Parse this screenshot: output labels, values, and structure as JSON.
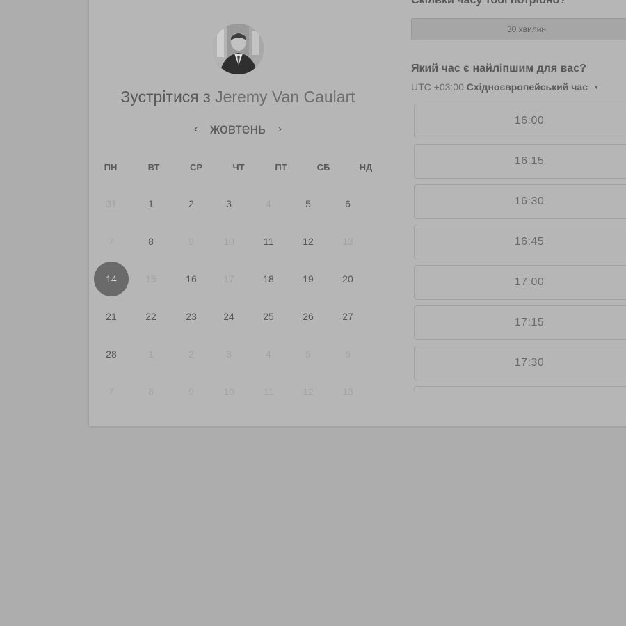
{
  "host": {
    "title_prefix": "Зустрітися з",
    "name": "Jeremy Van Caulart"
  },
  "calendar": {
    "month": "жовтень",
    "prev_icon": "chevron-left-icon",
    "next_icon": "chevron-right-icon",
    "weekdays": [
      "ПН",
      "ВТ",
      "СР",
      "ЧТ",
      "ПТ",
      "СБ",
      "НД"
    ],
    "weeks": [
      [
        {
          "d": "31",
          "muted": true
        },
        {
          "d": "1"
        },
        {
          "d": "2"
        },
        {
          "d": "3"
        },
        {
          "d": "4",
          "muted": true
        },
        {
          "d": "5"
        },
        {
          "d": "6"
        }
      ],
      [
        {
          "d": "7",
          "muted": true
        },
        {
          "d": "8"
        },
        {
          "d": "9",
          "muted": true
        },
        {
          "d": "10",
          "muted": true
        },
        {
          "d": "11"
        },
        {
          "d": "12"
        },
        {
          "d": "13",
          "muted": true
        }
      ],
      [
        {
          "d": "14",
          "selected": true
        },
        {
          "d": "15",
          "muted": true
        },
        {
          "d": "16"
        },
        {
          "d": "17",
          "muted": true
        },
        {
          "d": "18"
        },
        {
          "d": "19"
        },
        {
          "d": "20"
        }
      ],
      [
        {
          "d": "21"
        },
        {
          "d": "22"
        },
        {
          "d": "23"
        },
        {
          "d": "24"
        },
        {
          "d": "25"
        },
        {
          "d": "26"
        },
        {
          "d": "27"
        }
      ],
      [
        {
          "d": "28"
        },
        {
          "d": "1",
          "muted": true
        },
        {
          "d": "2",
          "muted": true
        },
        {
          "d": "3",
          "muted": true
        },
        {
          "d": "4",
          "muted": true
        },
        {
          "d": "5",
          "muted": true
        },
        {
          "d": "6",
          "muted": true
        }
      ],
      [
        {
          "d": "7",
          "muted": true
        },
        {
          "d": "8",
          "muted": true
        },
        {
          "d": "9",
          "muted": true
        },
        {
          "d": "10",
          "muted": true
        },
        {
          "d": "11",
          "muted": true
        },
        {
          "d": "12",
          "muted": true
        },
        {
          "d": "13",
          "muted": true
        }
      ]
    ]
  },
  "booking": {
    "duration_question": "Скільки часу тобі потрібно?",
    "duration_selected": "30 хвилин",
    "time_question": "Який час є найліпшим для вас?",
    "timezone_offset": "UTC +03:00",
    "timezone_name": "Східноєвропейський час",
    "timezone_caret_icon": "caret-down-icon",
    "slots": [
      "16:00",
      "16:15",
      "16:30",
      "16:45",
      "17:00",
      "17:15",
      "17:30",
      ""
    ]
  },
  "colors": {
    "overlay_background": "#adadad",
    "card_background": "#b6b6b6",
    "selected_day": "#6a6a6a"
  }
}
